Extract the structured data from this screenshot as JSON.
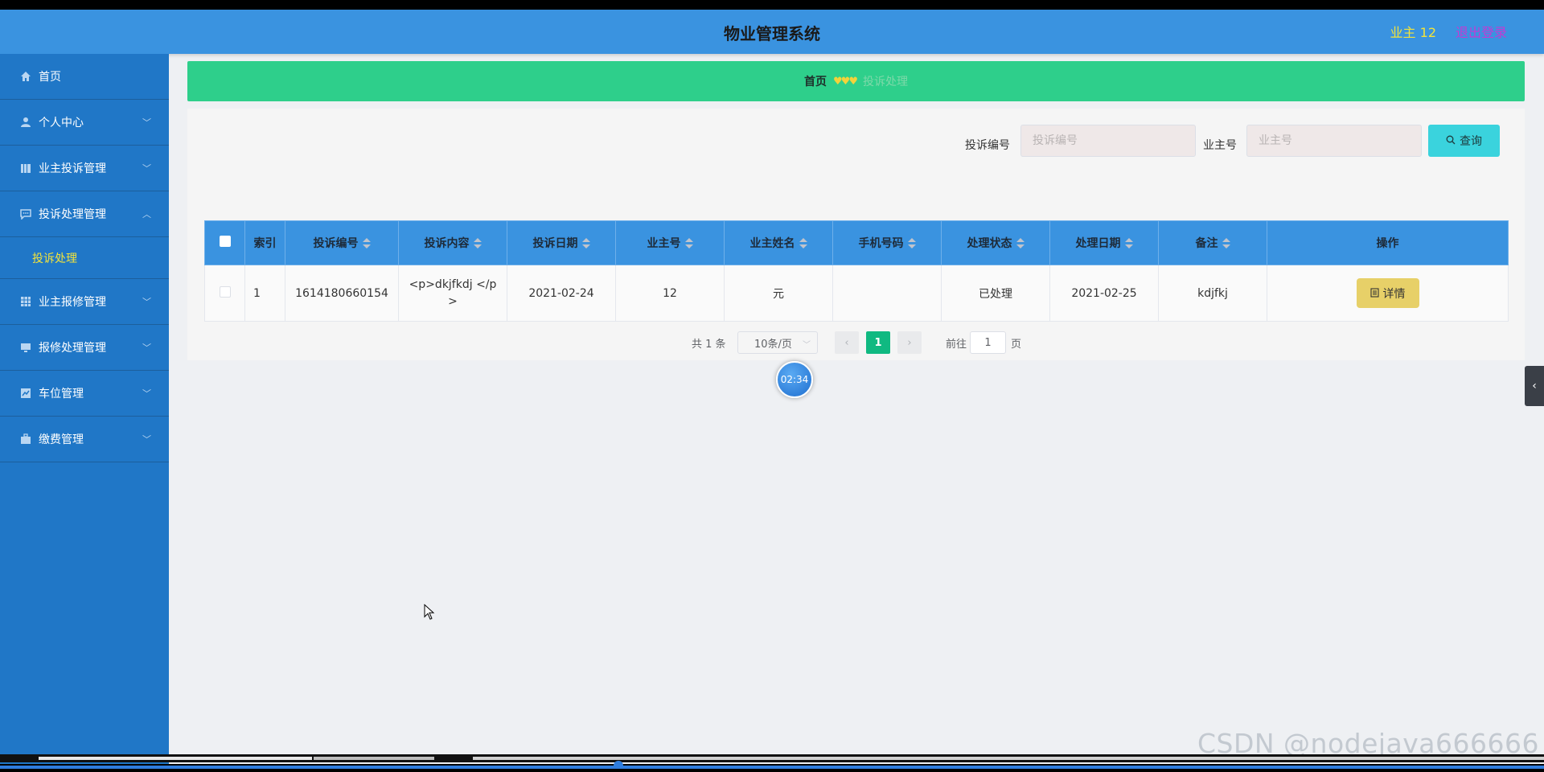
{
  "header": {
    "title": "物业管理系统",
    "user": "业主 12",
    "logout": "退出登录"
  },
  "sidebar": {
    "items": [
      {
        "label": "首页",
        "icon": "home-icon"
      },
      {
        "label": "个人中心",
        "icon": "user-icon"
      },
      {
        "label": "业主投诉管理",
        "icon": "book-icon"
      },
      {
        "label": "投诉处理管理",
        "icon": "chat-icon",
        "expanded": true
      },
      {
        "label": "业主报修管理",
        "icon": "grid-icon"
      },
      {
        "label": "报修处理管理",
        "icon": "monitor-icon"
      },
      {
        "label": "车位管理",
        "icon": "chart-icon"
      },
      {
        "label": "缴费管理",
        "icon": "briefcase-icon"
      }
    ],
    "sub_item": "投诉处理"
  },
  "breadcrumb": {
    "home": "首页",
    "separator": "♥♥♥",
    "current": "投诉处理"
  },
  "search": {
    "label1": "投诉编号",
    "placeholder1": "投诉编号",
    "label2": "业主号",
    "placeholder2": "业主号",
    "button": "查询"
  },
  "table": {
    "headers": [
      "索引",
      "投诉编号",
      "投诉内容",
      "投诉日期",
      "业主号",
      "业主姓名",
      "手机号码",
      "处理状态",
      "处理日期",
      "备注",
      "操作"
    ],
    "rows": [
      {
        "index": "1",
        "complaint_no": "1614180660154",
        "content": "<p>dkjfkdj </p>",
        "date": "2021-02-24",
        "owner_no": "12",
        "owner_name": "元",
        "phone": "",
        "status": "已处理",
        "handle_date": "2021-02-25",
        "remark": "kdjfkj",
        "action": "详情"
      }
    ]
  },
  "pagination": {
    "total": "共 1 条",
    "page_size": "10条/页",
    "current_page": "1",
    "goto_label": "前往",
    "goto_value": "1",
    "page_unit": "页"
  },
  "timer": "02:34",
  "watermark": "CSDN @nodejava666666",
  "colors": {
    "header": "#3a93e0",
    "sidebar": "#2077c7",
    "breadcrumb": "#2ecf8b",
    "search_button": "#3ad3dd",
    "detail_button": "#e7d068",
    "active_page": "#10b981"
  }
}
